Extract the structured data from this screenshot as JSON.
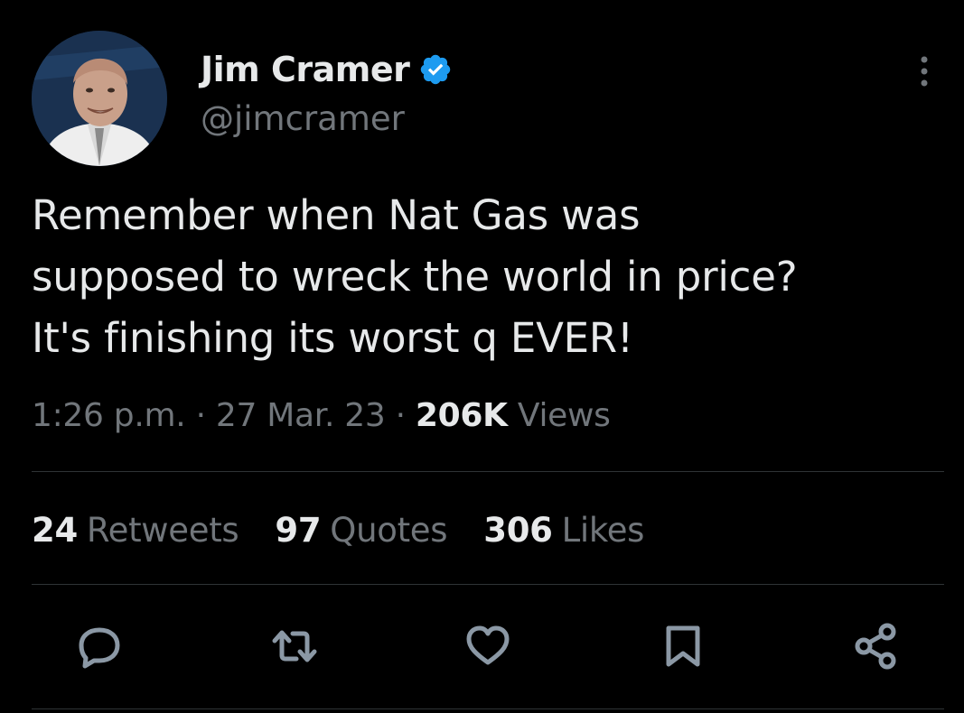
{
  "author": {
    "name": "Jim Cramer",
    "handle": "@jimcramer",
    "avatar_icon": "avatar-photo",
    "verified_icon": "verified-badge-icon",
    "verified_color": "#1d9bf0"
  },
  "tweet": {
    "text": "Remember when Nat Gas was\nsupposed to wreck the world in price?\nIt's finishing its worst q EVER!",
    "time": "1:26 p.m.",
    "sep1": "·",
    "date": "27 Mar. 23",
    "sep2": "·",
    "views_count": "206K",
    "views_label": "Views"
  },
  "stats": {
    "retweets_count": "24",
    "retweets_label": "Retweets",
    "quotes_count": "97",
    "quotes_label": "Quotes",
    "likes_count": "306",
    "likes_label": "Likes"
  },
  "actions": [
    "reply-icon",
    "retweet-icon",
    "like-icon",
    "bookmark-icon",
    "share-icon"
  ],
  "colors": {
    "background": "#000000",
    "text_primary": "#e7e9ea",
    "text_secondary": "#71767b",
    "divider": "#2f3336"
  }
}
